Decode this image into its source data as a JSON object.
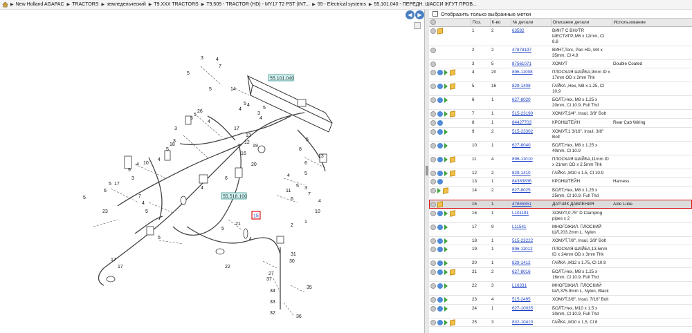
{
  "breadcrumb": [
    "New Holland AGAPAC",
    "TRACTORS",
    "земледельческий",
    "T9.XXX TRACTORS",
    "T9.505 - TRACTOR (HD) - MY17 T2 PST (INT...",
    "55 - Electrical systems",
    "55.101.040 - ПЕРЕДН. ШАССИ ЖГУТ ПРОВ..."
  ],
  "filter": {
    "label": "Отобразить только выбранные метки"
  },
  "table": {
    "headers": [
      "Поз.",
      "К-во",
      "№ детали",
      "Описание детали",
      "Использование"
    ],
    "rows": [
      {
        "pos": "1",
        "qty": "2",
        "part": "63582",
        "desc": "ВИНТ С ВНУТР. ШЕСТИГР.,М6 x 12mm, Cl 8.8",
        "use": "",
        "icons": [
          "grey",
          "box"
        ]
      },
      {
        "pos": "2",
        "qty": "2",
        "part": "47878197",
        "desc": "ВИНТ,Torx, Pan HD, M4 x 35mm, Cl 4.8",
        "use": "",
        "icons": [
          "grey"
        ]
      },
      {
        "pos": "3",
        "qty": "5",
        "part": "87561071",
        "desc": "ХОМУТ",
        "use": "Double Coated",
        "icons": [
          "grey"
        ]
      },
      {
        "pos": "4",
        "qty": "20",
        "part": "896-11008",
        "desc": "ПЛОСКАЯ ШАЙБА,9mm ID x 17mm OD x 2mm Thk",
        "use": "",
        "icons": [
          "grey",
          "blue",
          "green",
          "box"
        ]
      },
      {
        "pos": "5",
        "qty": "16",
        "part": "829-1408",
        "desc": "ГАЙКА ,Hex, M8 x 1.25, Cl 10.9",
        "use": "",
        "icons": [
          "grey",
          "blue",
          "green",
          "box"
        ]
      },
      {
        "pos": "6",
        "qty": "1",
        "part": "627-8020",
        "desc": "БОЛТ,Hex, M8 x 1.25 x 20mm, Cl 10.9, Full Thd",
        "use": "",
        "icons": [
          "grey",
          "blue",
          "green"
        ]
      },
      {
        "pos": "7",
        "qty": "1",
        "part": "515-23190",
        "desc": "ХОМУТ,3/4\", Insul, 3/8\" Bolt",
        "use": "",
        "icons": [
          "grey",
          "blue",
          "green",
          "box"
        ]
      },
      {
        "pos": "8",
        "qty": "1",
        "part": "84427703",
        "desc": "КРОНШТЕЙН",
        "use": "Rear Cab Wiring",
        "icons": [
          "grey",
          "blue"
        ]
      },
      {
        "pos": "9",
        "qty": "2",
        "part": "515-23302",
        "desc": "ХОМУТ,1 3/16\", Insul, 3/8\" Bolt",
        "use": "",
        "icons": [
          "grey",
          "blue",
          "green"
        ]
      },
      {
        "pos": "10",
        "qty": "1",
        "part": "627-8040",
        "desc": "БОЛТ,Hex, M8 x 1.25 x 40mm, Cl 10.9",
        "use": "",
        "icons": [
          "grey",
          "blue",
          "green"
        ]
      },
      {
        "pos": "11",
        "qty": "4",
        "part": "896-11010",
        "desc": "ПЛОСКАЯ ШАЙБА,11mm ID x 21mm OD x 2.5mm Thk",
        "use": "",
        "icons": [
          "grey",
          "blue",
          "green",
          "box"
        ]
      },
      {
        "pos": "12",
        "qty": "2",
        "part": "829-1410",
        "desc": "ГАЙКА ,M10 x 1.5, Cl 10.9",
        "use": "",
        "icons": [
          "grey",
          "blue",
          "green",
          "box"
        ]
      },
      {
        "pos": "13",
        "qty": "1",
        "part": "84383836",
        "desc": "КРОНШТЕЙН",
        "use": "Harness",
        "icons": [
          "grey",
          "blue"
        ]
      },
      {
        "pos": "14",
        "qty": "2",
        "part": "627-8025",
        "desc": "БОЛТ,Hex, M8 x 1.25 x 25mm, Cl 10.9, Full Thd",
        "use": "",
        "icons": [
          "grey",
          "green",
          "box"
        ]
      },
      {
        "pos": "15",
        "qty": "1",
        "part": "47655851",
        "desc": "ДАТЧИК ДАВЛЕНИЯ",
        "use": "Axle Lube",
        "icons": [
          "grey",
          "box"
        ],
        "selected": true
      },
      {
        "pos": "16",
        "qty": "1",
        "part": "L101181",
        "desc": "ХОМУТ,0.75\" D Clamping pipes x 2",
        "use": "",
        "icons": [
          "grey",
          "blue",
          "green",
          "box"
        ]
      },
      {
        "pos": "17",
        "qty": "9",
        "part": "L11541",
        "desc": "МНОГОЖИЛ. ПЛОСКИЙ ШЛ,203.2mm L, Nylon",
        "use": "",
        "icons": [
          "grey",
          "blue",
          "green"
        ]
      },
      {
        "pos": "18",
        "qty": "1",
        "part": "515-23222",
        "desc": "ХОМУТ,7/8\", Insul, 3/8\" Bolt",
        "use": "",
        "icons": [
          "grey",
          "blue",
          "green"
        ]
      },
      {
        "pos": "19",
        "qty": "1",
        "part": "896-11012",
        "desc": "ПЛОСКАЯ ШАЙБА,13.5mm ID x 24mm OD x 3mm Thk",
        "use": "",
        "icons": [
          "grey",
          "blue",
          "green"
        ]
      },
      {
        "pos": "20",
        "qty": "1",
        "part": "829-1412",
        "desc": "ГАЙКА ,M12 x 1.75, Cl 10.9",
        "use": "",
        "icons": [
          "grey",
          "blue",
          "green"
        ]
      },
      {
        "pos": "21",
        "qty": "2",
        "part": "627-8016",
        "desc": "БОЛТ,Hex, M8 x 1.25 x 16mm, Cl 10.9, Full Thd",
        "use": "",
        "icons": [
          "grey",
          "blue",
          "green",
          "box"
        ]
      },
      {
        "pos": "22",
        "qty": "3",
        "part": "L16331",
        "desc": "МНОГОЖИЛ. ПЛОСКИЙ ШЛ,375.9mm L, Nylon, Black",
        "use": "",
        "icons": [
          "grey",
          "blue",
          "green"
        ]
      },
      {
        "pos": "23",
        "qty": "4",
        "part": "515-2495",
        "desc": "ХОМУТ,3/8\", Insul, 7/16\" Bolt",
        "use": "",
        "icons": [
          "grey",
          "blue",
          "green"
        ]
      },
      {
        "pos": "24",
        "qty": "1",
        "part": "627-10035",
        "desc": "БОЛТ,Hex, M10 x 1.5 x 30mm, Cl 10.9, Full Thd",
        "use": "",
        "icons": [
          "grey",
          "blue",
          "green"
        ]
      },
      {
        "pos": "25",
        "qty": "3",
        "part": "832-10410",
        "desc": "ГАЙКА ,M10 x 1.5, Cl 8",
        "use": "",
        "icons": [
          "grey",
          "blue",
          "green",
          "box"
        ]
      }
    ]
  },
  "diagram": {
    "ref_boxes": [
      "55.101.040",
      "55.518.100"
    ],
    "highlight_label": "15",
    "callouts": [
      "5",
      "7",
      "4",
      "3",
      "5",
      "14",
      "4",
      "5",
      "4",
      "26",
      "5",
      "5",
      "4",
      "3",
      "17",
      "3",
      "18",
      "5",
      "4",
      "10",
      "4",
      "9",
      "3",
      "6",
      "4",
      "20",
      "16",
      "19",
      "13",
      "6",
      "5",
      "4",
      "5",
      "3",
      "7",
      "6",
      "5",
      "17",
      "5",
      "4",
      "7",
      "5",
      "10",
      "13",
      "12",
      "5",
      "3",
      "4",
      "5",
      "8",
      "11",
      "6",
      "4",
      "5",
      "4",
      "5",
      "17",
      "21",
      "23",
      "17",
      "22",
      "1",
      "2",
      "31",
      "30",
      "37",
      "27",
      "34",
      "33",
      "32",
      "35",
      "36"
    ]
  },
  "colors": {
    "selected_outline": "#d11111",
    "ref_box": "#2c8f8a",
    "link": "#1a3fc4"
  }
}
